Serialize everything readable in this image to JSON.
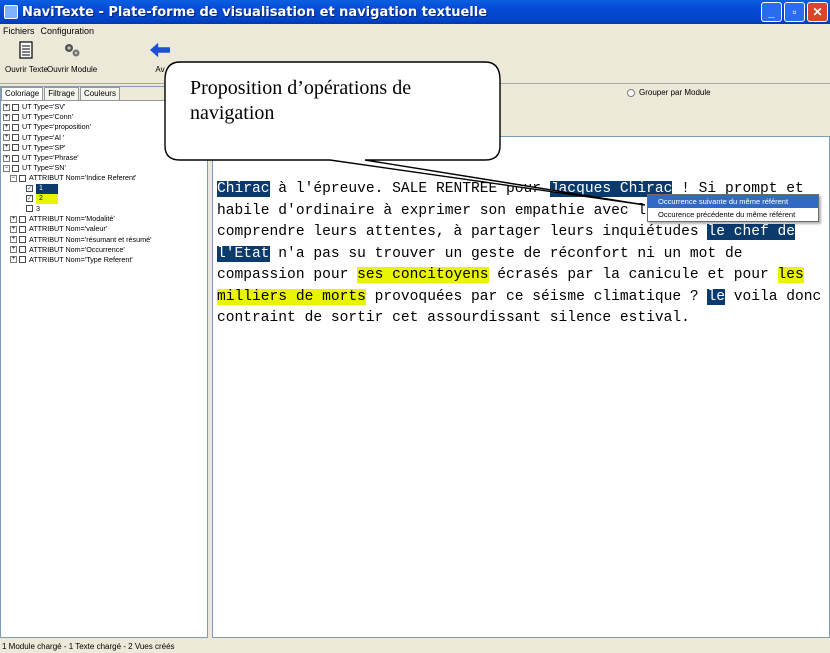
{
  "window": {
    "title": "NaviTexte - Plate-forme de visualisation et navigation textuelle",
    "minimize": "_",
    "maximize": "▫",
    "close": "✕"
  },
  "menu": [
    "Fichiers",
    "Configuration"
  ],
  "toolbar": {
    "open_text": "Ouvrir Texte",
    "open_module": "Ouvrir Module",
    "truncated_label": "Av"
  },
  "left_tabs": [
    "Coloriage",
    "Filtrage",
    "Couleurs"
  ],
  "tree": [
    {
      "label": "UT Type='SV'",
      "level": 0,
      "exp": "+"
    },
    {
      "label": "UT Type='Conn'",
      "level": 0,
      "exp": "+"
    },
    {
      "label": "UT Type='proposition'",
      "level": 0,
      "exp": "+"
    },
    {
      "label": "UT Type='Al '",
      "level": 0,
      "exp": "+"
    },
    {
      "label": "UT Type='SP'",
      "level": 0,
      "exp": "+"
    },
    {
      "label": "UT Type='Phrase'",
      "level": 0,
      "exp": "+"
    },
    {
      "label": "UT Type='SN'",
      "level": 0,
      "exp": "−"
    },
    {
      "label": "ATTRIBUT Nom='Indice Referent'",
      "level": 1,
      "exp": "−"
    },
    {
      "label": "1",
      "level": 2,
      "checked": true,
      "style": "navy"
    },
    {
      "label": "2",
      "level": 2,
      "checked": true,
      "style": "yellow"
    },
    {
      "label": "3",
      "level": 2,
      "checked": false,
      "style": ""
    },
    {
      "label": "ATTRIBUT Nom='Modalité'",
      "level": 1,
      "exp": "+"
    },
    {
      "label": "ATTRIBUT Nom='valeur'",
      "level": 1,
      "exp": "+"
    },
    {
      "label": "ATTRIBUT Nom='résumant et résumé'",
      "level": 1,
      "exp": "+"
    },
    {
      "label": "ATTRIBUT Nom='Occurrence'",
      "level": 1,
      "exp": "+"
    },
    {
      "label": "ATTRIBUT Nom='Type Referent'",
      "level": 1,
      "exp": "+"
    }
  ],
  "radio_group_label": "Grouper par Module",
  "callout_text": "Proposition d’opérations de navigation",
  "text_segments": [
    {
      "t": "Chirac",
      "s": "navy"
    },
    {
      "t": " à l'épreuve. SALE RENTREE pour ",
      "s": ""
    },
    {
      "t": "Jacques Chirac",
      "s": "navy"
    },
    {
      "t": " ! Si prompt et habile d'ordinaire à exprimer son empathie avec les Français, à comprendre leurs attentes, à partager leurs inquiétudes ",
      "s": ""
    },
    {
      "t": "le chef de l'Etat",
      "s": "navy"
    },
    {
      "t": " n'a pas su trouver un geste de réconfort ni un mot de compassion pour ",
      "s": ""
    },
    {
      "t": "ses concitoyens",
      "s": "yellow"
    },
    {
      "t": " écrasés par la canicule et pour ",
      "s": ""
    },
    {
      "t": "les milliers de morts",
      "s": "yellow"
    },
    {
      "t": " provoquées par ce séisme climatique ? ",
      "s": ""
    },
    {
      "t": "le",
      "s": "navy"
    },
    {
      "t": " voila donc contraint de sortir cet assourdissant silence estival.",
      "s": ""
    }
  ],
  "context_menu": {
    "next": "Occurrence suivante du même référent",
    "prev": "Occurence précédente du même référent"
  },
  "status": "1 Module chargé   -   1 Texte chargé   -   2 Vues créés",
  "colors": {
    "highlight_navy": "#0b3a6d",
    "highlight_yellow": "#e8f400",
    "titlebar": "#0449d6"
  }
}
